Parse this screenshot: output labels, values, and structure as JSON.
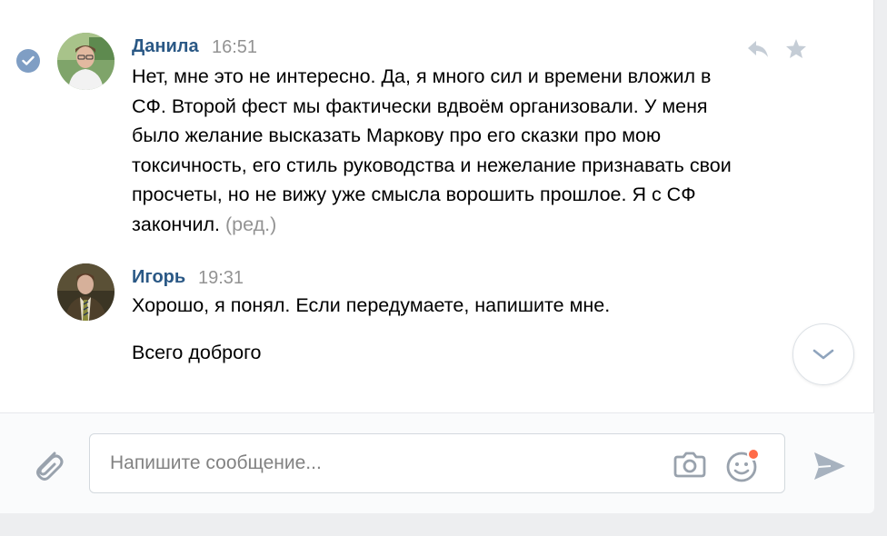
{
  "messages": [
    {
      "author": "Данила",
      "time": "16:51",
      "text": "Нет, мне это не интересно. Да, я много сил и времени вложил в СФ. Второй фест мы фактически вдвоём организовали. У меня было желание высказать Маркову про его сказки про мою токсичность, его стиль руководства и нежелание признавать свои просчеты, но не вижу уже смысла ворошить прошлое. Я с СФ закончил.",
      "edited_label": "(ред.)",
      "selected": true
    },
    {
      "author": "Игорь",
      "time": "19:31",
      "text": "Хорошо, я понял. Если передумаете, напишите мне.",
      "text_2": "Всего доброго"
    }
  ],
  "composer": {
    "placeholder": "Напишите сообщение...",
    "value": ""
  },
  "icons": {
    "selected": "check-icon",
    "reply": "reply-icon",
    "favorite": "star-icon",
    "scroll": "chevron-down-icon",
    "attach": "paperclip-icon",
    "camera": "camera-icon",
    "emoji": "smile-icon",
    "send": "send-icon"
  },
  "colors": {
    "author": "#2a5885",
    "muted": "#939393",
    "icon": "#aeb7c2",
    "notification_dot": "#ff6b48"
  }
}
